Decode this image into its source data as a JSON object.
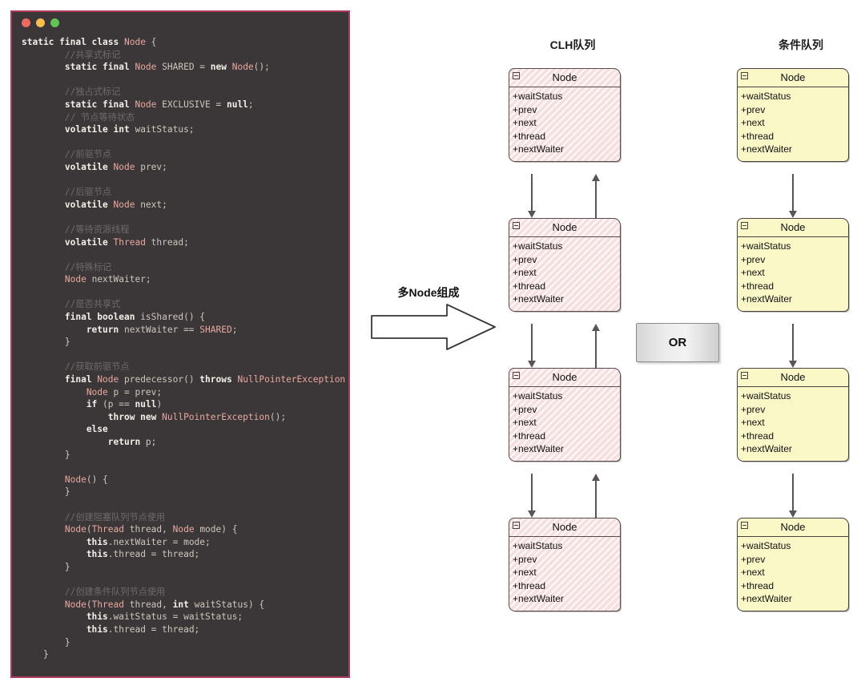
{
  "window": {
    "traffic_lights": [
      "close",
      "minimize",
      "zoom"
    ],
    "code_lines": [
      [
        {
          "t": "kw",
          "s": "static final class "
        },
        {
          "t": "typ",
          "s": "Node"
        },
        {
          "t": "pun",
          "s": " {"
        }
      ],
      [
        {
          "t": "cm",
          "s": "        //共享式标记"
        }
      ],
      [
        {
          "t": "kw",
          "s": "        static final "
        },
        {
          "t": "typ",
          "s": "Node"
        },
        {
          "t": "id",
          "s": " SHARED = "
        },
        {
          "t": "kw",
          "s": "new "
        },
        {
          "t": "typ",
          "s": "Node"
        },
        {
          "t": "pun",
          "s": "();"
        }
      ],
      [],
      [
        {
          "t": "cm",
          "s": "        //独占式标记"
        }
      ],
      [
        {
          "t": "kw",
          "s": "        static final "
        },
        {
          "t": "typ",
          "s": "Node"
        },
        {
          "t": "id",
          "s": " EXCLUSIVE = "
        },
        {
          "t": "kw",
          "s": "null"
        },
        {
          "t": "pun",
          "s": ";"
        }
      ],
      [
        {
          "t": "cm",
          "s": "        // 节点等待状态"
        }
      ],
      [
        {
          "t": "kw",
          "s": "        volatile int "
        },
        {
          "t": "id",
          "s": "waitStatus;"
        }
      ],
      [],
      [
        {
          "t": "cm",
          "s": "        //前驱节点"
        }
      ],
      [
        {
          "t": "kw",
          "s": "        volatile "
        },
        {
          "t": "typ",
          "s": "Node"
        },
        {
          "t": "id",
          "s": " prev;"
        }
      ],
      [],
      [
        {
          "t": "cm",
          "s": "        //后驱节点"
        }
      ],
      [
        {
          "t": "kw",
          "s": "        volatile "
        },
        {
          "t": "typ",
          "s": "Node"
        },
        {
          "t": "id",
          "s": " next;"
        }
      ],
      [],
      [
        {
          "t": "cm",
          "s": "        //等待资源线程"
        }
      ],
      [
        {
          "t": "kw",
          "s": "        volatile "
        },
        {
          "t": "typ",
          "s": "Thread"
        },
        {
          "t": "id",
          "s": " thread;"
        }
      ],
      [],
      [
        {
          "t": "cm",
          "s": "        //特殊标记"
        }
      ],
      [
        {
          "t": "typ",
          "s": "        Node"
        },
        {
          "t": "id",
          "s": " nextWaiter;"
        }
      ],
      [],
      [
        {
          "t": "cm",
          "s": "        //是否共享式"
        }
      ],
      [
        {
          "t": "kw",
          "s": "        final boolean "
        },
        {
          "t": "id",
          "s": "isShared"
        },
        {
          "t": "pun",
          "s": "() {"
        }
      ],
      [
        {
          "t": "kw",
          "s": "            return "
        },
        {
          "t": "id",
          "s": "nextWaiter == "
        },
        {
          "t": "typ",
          "s": "SHARED"
        },
        {
          "t": "pun",
          "s": ";"
        }
      ],
      [
        {
          "t": "pun",
          "s": "        }"
        }
      ],
      [],
      [
        {
          "t": "cm",
          "s": "        //获取前驱节点"
        }
      ],
      [
        {
          "t": "kw",
          "s": "        final "
        },
        {
          "t": "typ",
          "s": "Node"
        },
        {
          "t": "id",
          "s": " predecessor"
        },
        {
          "t": "pun",
          "s": "() "
        },
        {
          "t": "kw",
          "s": "throws "
        },
        {
          "t": "typ",
          "s": "NullPointerException"
        },
        {
          "t": "pun",
          "s": " {"
        }
      ],
      [
        {
          "t": "typ",
          "s": "            Node"
        },
        {
          "t": "id",
          "s": " p = prev;"
        }
      ],
      [
        {
          "t": "kw",
          "s": "            if "
        },
        {
          "t": "pun",
          "s": "("
        },
        {
          "t": "id",
          "s": "p == "
        },
        {
          "t": "kw",
          "s": "null"
        },
        {
          "t": "pun",
          "s": ")"
        }
      ],
      [
        {
          "t": "kw",
          "s": "                throw new "
        },
        {
          "t": "typ",
          "s": "NullPointerException"
        },
        {
          "t": "pun",
          "s": "();"
        }
      ],
      [
        {
          "t": "kw",
          "s": "            else"
        }
      ],
      [
        {
          "t": "kw",
          "s": "                return "
        },
        {
          "t": "id",
          "s": "p;"
        }
      ],
      [
        {
          "t": "pun",
          "s": "        }"
        }
      ],
      [],
      [
        {
          "t": "typ",
          "s": "        Node"
        },
        {
          "t": "pun",
          "s": "() {"
        }
      ],
      [
        {
          "t": "pun",
          "s": "        }"
        }
      ],
      [],
      [
        {
          "t": "cm",
          "s": "        //创建阻塞队列节点使用"
        }
      ],
      [
        {
          "t": "typ",
          "s": "        Node"
        },
        {
          "t": "pun",
          "s": "("
        },
        {
          "t": "typ",
          "s": "Thread"
        },
        {
          "t": "id",
          "s": " thread, "
        },
        {
          "t": "typ",
          "s": "Node"
        },
        {
          "t": "id",
          "s": " mode"
        },
        {
          "t": "pun",
          "s": ") {"
        }
      ],
      [
        {
          "t": "kw",
          "s": "            this"
        },
        {
          "t": "id",
          "s": ".nextWaiter = mode;"
        }
      ],
      [
        {
          "t": "kw",
          "s": "            this"
        },
        {
          "t": "id",
          "s": ".thread = thread;"
        }
      ],
      [
        {
          "t": "pun",
          "s": "        }"
        }
      ],
      [],
      [
        {
          "t": "cm",
          "s": "        //创建条件队列节点使用"
        }
      ],
      [
        {
          "t": "typ",
          "s": "        Node"
        },
        {
          "t": "pun",
          "s": "("
        },
        {
          "t": "typ",
          "s": "Thread"
        },
        {
          "t": "id",
          "s": " thread, "
        },
        {
          "t": "kw",
          "s": "int "
        },
        {
          "t": "id",
          "s": "waitStatus"
        },
        {
          "t": "pun",
          "s": ") {"
        }
      ],
      [
        {
          "t": "kw",
          "s": "            this"
        },
        {
          "t": "id",
          "s": ".waitStatus = waitStatus;"
        }
      ],
      [
        {
          "t": "kw",
          "s": "            this"
        },
        {
          "t": "id",
          "s": ".thread = thread;"
        }
      ],
      [
        {
          "t": "pun",
          "s": "        }"
        }
      ],
      [
        {
          "t": "pun",
          "s": "    }"
        }
      ]
    ]
  },
  "diagram": {
    "clh_title": "CLH队列",
    "condition_title": "条件队列",
    "transform_label": "多Node组成",
    "or_label": "OR",
    "node_header": "Node",
    "node_fields": [
      "+waitStatus",
      "+prev",
      "+next",
      "+thread",
      "+nextWaiter"
    ],
    "clh_node_count": 4,
    "condition_node_count": 4,
    "clh_node_color": "#f7dfe0",
    "condition_node_color": "#fbf8c8",
    "border_color": "#4a4142",
    "arrow_color": "#5a5456",
    "window_border_color": "#b03a5b",
    "code_background": "#3b3637"
  }
}
